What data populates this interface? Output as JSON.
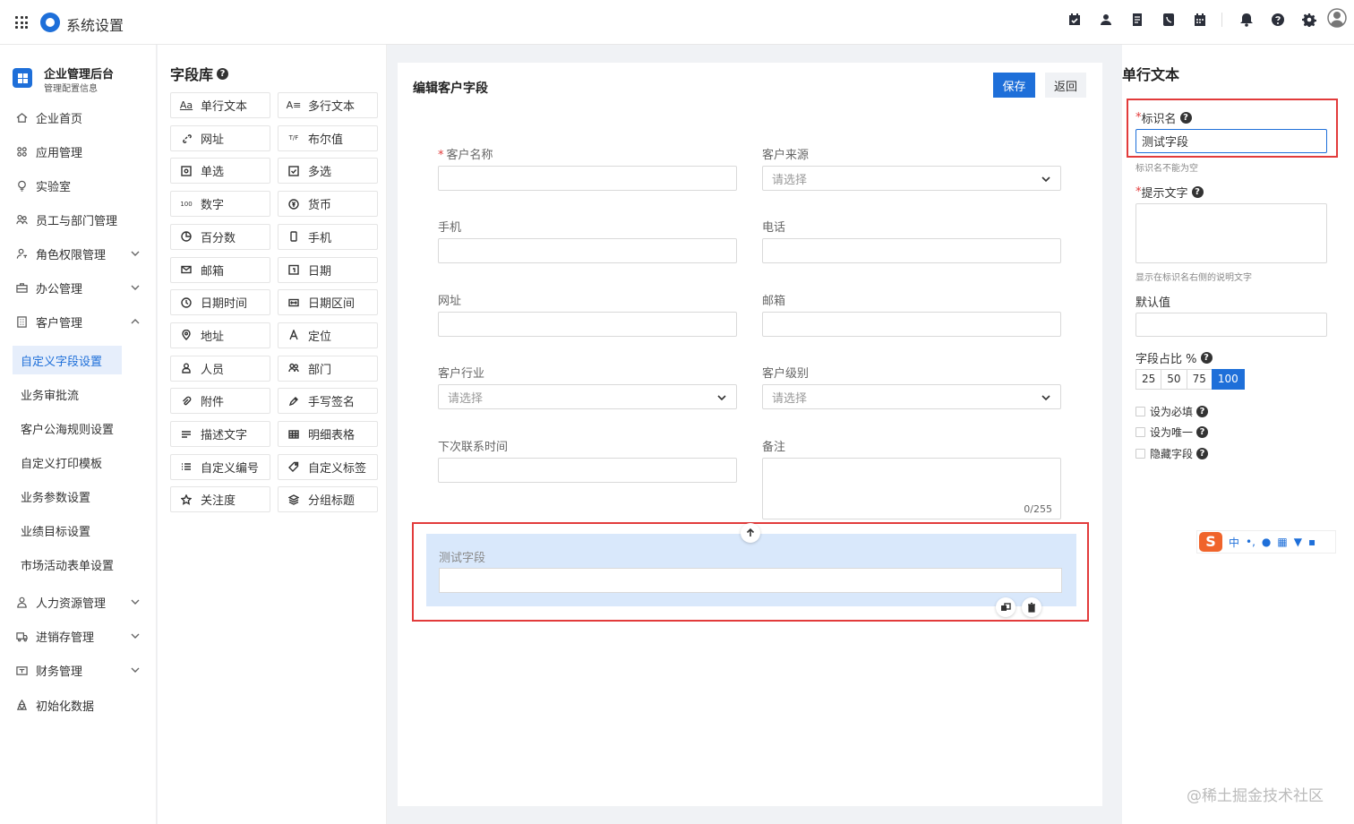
{
  "header": {
    "app_title": "系统设置"
  },
  "sidebar": {
    "brand_title": "企业管理后台",
    "brand_subtitle": "管理配置信息",
    "items": [
      {
        "label": "企业首页"
      },
      {
        "label": "应用管理"
      },
      {
        "label": "实验室"
      },
      {
        "label": "员工与部门管理"
      },
      {
        "label": "角色权限管理"
      },
      {
        "label": "办公管理"
      },
      {
        "label": "客户管理"
      }
    ],
    "sub_items": [
      {
        "label": "自定义字段设置"
      },
      {
        "label": "业务审批流"
      },
      {
        "label": "客户公海规则设置"
      },
      {
        "label": "自定义打印模板"
      },
      {
        "label": "业务参数设置"
      },
      {
        "label": "业绩目标设置"
      },
      {
        "label": "市场活动表单设置"
      }
    ],
    "items_bottom": [
      {
        "label": "人力资源管理"
      },
      {
        "label": "进销存管理"
      },
      {
        "label": "财务管理"
      },
      {
        "label": "初始化数据"
      }
    ]
  },
  "library": {
    "title": "字段库",
    "items": [
      {
        "label": "单行文本",
        "icon": "Aa"
      },
      {
        "label": "多行文本",
        "icon": "A≡"
      },
      {
        "label": "网址",
        "icon": "link-icon"
      },
      {
        "label": "布尔值",
        "icon": "T/F"
      },
      {
        "label": "单选",
        "icon": "radio-icon"
      },
      {
        "label": "多选",
        "icon": "checkbox-icon"
      },
      {
        "label": "数字",
        "icon": "100"
      },
      {
        "label": "货币",
        "icon": "currency-icon"
      },
      {
        "label": "百分数",
        "icon": "percent-icon"
      },
      {
        "label": "手机",
        "icon": "phone-icon"
      },
      {
        "label": "邮箱",
        "icon": "mail-icon"
      },
      {
        "label": "日期",
        "icon": "calendar-icon"
      },
      {
        "label": "日期时间",
        "icon": "clock-icon"
      },
      {
        "label": "日期区间",
        "icon": "date-range-icon"
      },
      {
        "label": "地址",
        "icon": "location-icon"
      },
      {
        "label": "定位",
        "icon": "navigate-icon"
      },
      {
        "label": "人员",
        "icon": "person-icon"
      },
      {
        "label": "部门",
        "icon": "group-icon"
      },
      {
        "label": "附件",
        "icon": "attachment-icon"
      },
      {
        "label": "手写签名",
        "icon": "pen-icon"
      },
      {
        "label": "描述文字",
        "icon": "text-icon"
      },
      {
        "label": "明细表格",
        "icon": "table-icon"
      },
      {
        "label": "自定义编号",
        "icon": "list-icon"
      },
      {
        "label": "自定义标签",
        "icon": "tag-icon"
      },
      {
        "label": "关注度",
        "icon": "star-icon"
      },
      {
        "label": "分组标题",
        "icon": "layers-icon"
      }
    ]
  },
  "editor": {
    "title": "编辑客户字段",
    "save_label": "保存",
    "back_label": "返回",
    "fields": [
      {
        "label": "客户名称",
        "required": "*"
      },
      {
        "label": "客户来源",
        "placeholder": "请选择"
      },
      {
        "label": "手机"
      },
      {
        "label": "电话"
      },
      {
        "label": "网址"
      },
      {
        "label": "邮箱"
      },
      {
        "label": "客户行业",
        "placeholder": "请选择"
      },
      {
        "label": "客户级别",
        "placeholder": "请选择"
      },
      {
        "label": "下次联系时间"
      },
      {
        "label": "备注",
        "counter": "0/255"
      }
    ],
    "new_field_label": "测试字段"
  },
  "props": {
    "title": "单行文本",
    "name_label": "标识名",
    "name_value": "测试字段",
    "name_hint": "标识名不能为空",
    "placeholder_label": "提示文字",
    "placeholder_hint": "显示在标识名右侧的说明文字",
    "default_label": "默认值",
    "ratio_label": "字段占比 %",
    "ratio_options": [
      "25",
      "50",
      "75",
      "100"
    ],
    "ratio_selected": "100",
    "checks": [
      "设为必填",
      "设为唯一",
      "隐藏字段"
    ],
    "required_mark": "*"
  },
  "ime": {
    "logo": "S",
    "mode": "中",
    "punct": "•,"
  },
  "watermark": "@稀土掘金技术社区",
  "colors": {
    "primary": "#1e6fd9",
    "highlight_border": "#e23b3b",
    "drop_bg": "#d9e8fb"
  }
}
